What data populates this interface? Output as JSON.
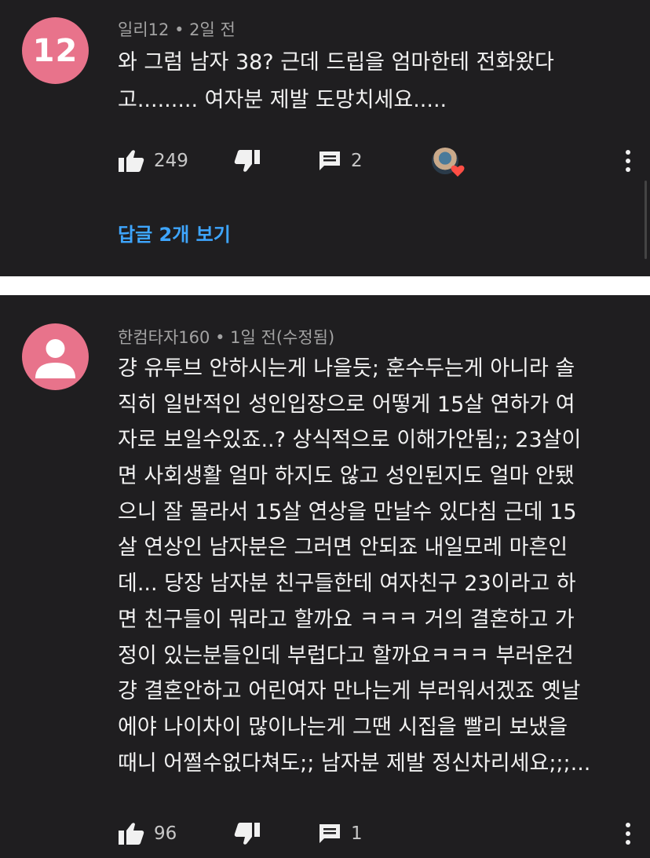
{
  "comments": [
    {
      "avatar_text": "12",
      "author": "일리12",
      "age": "2일 전",
      "lines": [
        "와 그럼 남자 38? 근데 드립을 엄마한테 전화왔다",
        "고......... 여자분 제발 도망치세요....."
      ],
      "likes": "249",
      "replies": "2",
      "view_replies": "답글 2개 보기"
    },
    {
      "author": "한컴타자160",
      "age": "1일 전(수정됨)",
      "lines": [
        "걍 유투브 안하시는게 나을듯; 훈수두는게 아니라 솔",
        "직히 일반적인 성인입장으로 어떻게 15살 연하가 여",
        "자로 보일수있죠..? 상식적으로 이해가안됨;; 23살이",
        "면 사회생활 얼마 하지도 않고 성인된지도 얼마 안됐",
        "으니 잘 몰라서 15살 연상을 만날수 있다침 근데 15",
        "살 연상인 남자분은 그러면 안되죠 내일모레 마흔인",
        "데... 당장 남자분 친구들한테 여자친구 23이라고 하",
        "면 친구들이 뭐라고 할까요 ㅋㅋㅋ 거의 결혼하고 가",
        "정이 있는분들인데 부럽다고 할까요ㅋㅋㅋ 부러운건",
        "걍 결혼안하고 어린여자 만나는게 부러워서겠죠 옛날",
        "에야 나이차이 많이나는게 그땐 시집을 빨리 보냈을",
        "때니 어쩔수없다쳐도;; 남자분 제발 정신차리세요;;;..."
      ],
      "likes": "96",
      "replies": "1"
    }
  ],
  "separator": "•",
  "icons": {
    "like": "thumbs-up-icon",
    "dislike": "thumbs-down-icon",
    "reply": "comment-icon",
    "more": "more-vert-icon",
    "heart": "heart-icon"
  },
  "colors": {
    "background": "#1f1e20",
    "avatar": "#e8738b",
    "link": "#3ea6ff",
    "heart": "#ff4e45"
  }
}
